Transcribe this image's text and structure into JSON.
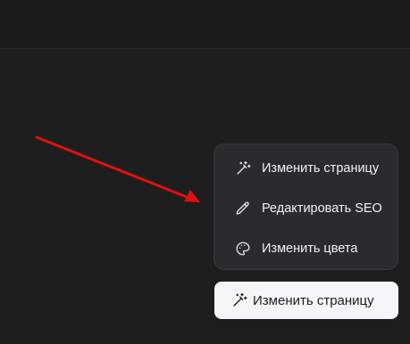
{
  "menu": {
    "items": [
      {
        "label": "Изменить страницу",
        "icon": "magic-wand-icon"
      },
      {
        "label": "Редактировать SEO",
        "icon": "pencil-icon"
      },
      {
        "label": "Изменить цвета",
        "icon": "palette-icon"
      }
    ]
  },
  "main_button": {
    "label": "Изменить страницу",
    "icon": "magic-wand-icon"
  },
  "annotation": {
    "arrow_color": "#e01010"
  },
  "colors": {
    "background": "#1e1e1e",
    "menu_background": "#2b2b2d",
    "button_background": "#f5f5f7"
  }
}
